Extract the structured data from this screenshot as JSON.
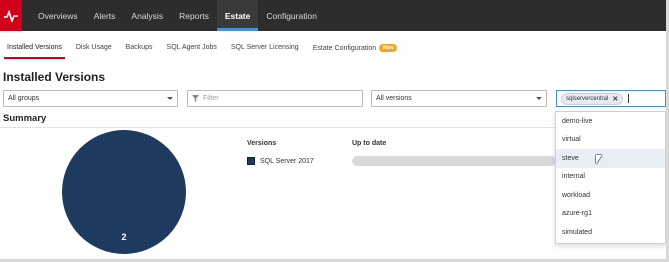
{
  "nav": {
    "logo_icon": "heartbeat-logo-icon",
    "items": [
      "Overviews",
      "Alerts",
      "Analysis",
      "Reports",
      "Estate",
      "Configuration"
    ],
    "active": "Estate"
  },
  "subnav": {
    "items": [
      "Installed Versions",
      "Disk Usage",
      "Backups",
      "SQL Agent Jobs",
      "SQL Server Licensing",
      "Estate Configuration"
    ],
    "badge": "New",
    "active": "Installed Versions"
  },
  "page": {
    "title": "Installed Versions"
  },
  "filters": {
    "group_value": "All groups",
    "filter_placeholder": "Filter",
    "version_value": "All versions",
    "selected_tag": "sqlservercentral"
  },
  "summary": {
    "title": "Summary",
    "pie_value": "2",
    "col_versions": "Versions",
    "col_up_to_date": "Up to date",
    "row_version": "SQL Server 2017",
    "up_to_date_fraction": 0.0
  },
  "tag_dropdown": {
    "options": [
      "demo-live",
      "virtual",
      "steve",
      "internal",
      "workload",
      "azure-rg1",
      "simulated"
    ],
    "hovered": "steve"
  },
  "colors": {
    "brand_red": "#d0021b",
    "nav_dark": "#2d2d2d",
    "pie_navy": "#1e3a5f",
    "accent_blue": "#4a90d9",
    "badge_orange": "#f5a623"
  }
}
